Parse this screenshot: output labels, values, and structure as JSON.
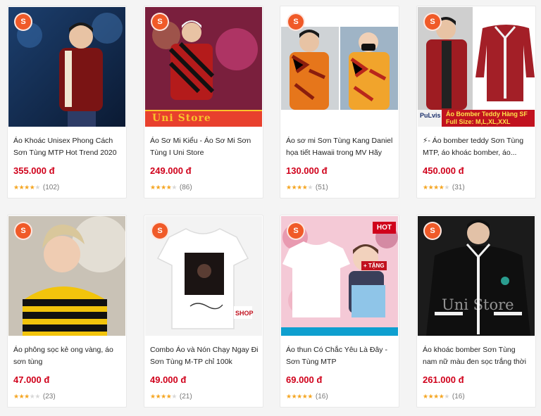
{
  "colors": {
    "price": "#d0011b",
    "star": "#f5a623",
    "shop_badge": "#f05a28"
  },
  "icons": {
    "shop": "shop-bag-icon",
    "star": "star-icon"
  },
  "products": [
    {
      "title": "Áo Khoác Unisex Phong Cách Sơn Tùng MTP Hot Trend 2020",
      "price": "355.000 đ",
      "rating": 4.5,
      "count": "(102)"
    },
    {
      "title": "Áo Sơ Mi Kiểu - Áo Sơ Mi Sơn Tùng I Uni Store",
      "price": "249.000 đ",
      "rating": 4.5,
      "count": "(86)",
      "overlay": "Uni Store"
    },
    {
      "title": "Áo sơ mi Sơn Tùng Kang Daniel họa tiết Hawaii trong MV Hãy tra...",
      "price": "130.000 đ",
      "rating": 4.5,
      "count": "(51)"
    },
    {
      "title": "⚡- Áo bomber teddy Sơn Tùng MTP, áo khoác bomber, áo...",
      "price": "450.000 đ",
      "rating": 4.5,
      "count": "(31)",
      "overlay_brand": "PuLvis",
      "overlay_title": "Áo Bomber Teddy Hàng SF",
      "overlay_size": "Full Size: M,L,XL,XXL"
    },
    {
      "title": "Áo phông sọc kẻ ong vàng, áo sơn tùng",
      "price": "47.000 đ",
      "rating": 3,
      "count": "(23)"
    },
    {
      "title": "Combo Áo và Nón Chạy Ngay Đi Sơn Tùng M-TP chỉ 100k",
      "price": "49.000 đ",
      "rating": 4.5,
      "count": "(21)",
      "overlay": "SHOP"
    },
    {
      "title": "Áo thun Có Chắc Yêu Là Đây - Sơn Tùng MTP",
      "price": "69.000 đ",
      "rating": 5,
      "count": "(16)",
      "overlay": "HOT",
      "overlay_tag": "+ TẶNG"
    },
    {
      "title": "Áo khoác bomber Sơn Tùng nam nữ màu đen sọc trắng thời trang...",
      "price": "261.000 đ",
      "rating": 4.5,
      "count": "(16)",
      "overlay": "Uni Store"
    }
  ]
}
